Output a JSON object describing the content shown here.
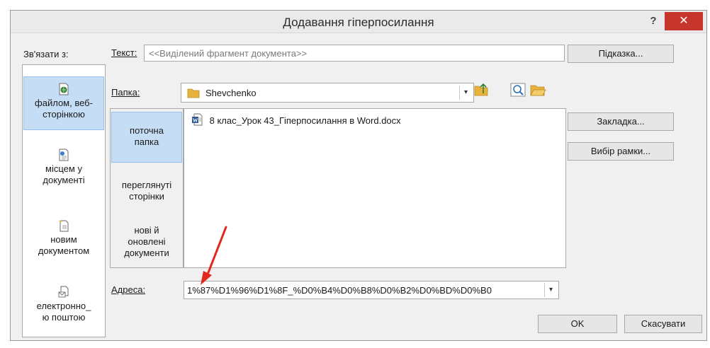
{
  "dialog": {
    "title": "Додавання гіперпосилання",
    "help_label": "?",
    "close_label": "✕"
  },
  "link_to": {
    "label": "Зв'язати з:",
    "items": [
      {
        "label_line1": "файлом, веб-",
        "label_line2": "сторінкою",
        "icon": "web-file-icon",
        "selected": true
      },
      {
        "label_line1": "місцем у",
        "label_line2": "документі",
        "icon": "place-in-document-icon",
        "selected": false
      },
      {
        "label_line1": "новим",
        "label_line2": "документом",
        "icon": "new-document-icon",
        "selected": false
      },
      {
        "label_line1": "електронно_",
        "label_line2": "ю поштою",
        "icon": "email-icon",
        "selected": false
      }
    ]
  },
  "text_to_display": {
    "label": "Текст:",
    "value": "<<Виділений фрагмент документа>>"
  },
  "buttons": {
    "screentip": "Підказка...",
    "bookmark": "Закладка...",
    "target_frame": "Вибір рамки...",
    "ok": "OK",
    "cancel": "Скасувати"
  },
  "folder": {
    "label": "Папка:",
    "value": "Shevchenko"
  },
  "look_in": {
    "items": [
      {
        "line1": "поточна",
        "line2": "папка",
        "line3": "",
        "selected": true
      },
      {
        "line1": "переглянуті",
        "line2": "сторінки",
        "line3": "",
        "selected": false
      },
      {
        "line1": "нові й",
        "line2": "оновлені",
        "line3": "документи",
        "selected": false
      }
    ]
  },
  "files": [
    {
      "name": "8 клас_Урок 43_Гіперпосилання в Word.docx",
      "icon": "word-document-icon"
    }
  ],
  "address": {
    "label": "Адреса:",
    "value": "1%87%D1%96%D1%8F_%D0%B4%D0%B8%D0%B2%D0%BD%D0%B0"
  },
  "colors": {
    "selection": "#c5ddf5",
    "close_button": "#c7362d",
    "annotation_arrow": "#e3271c"
  }
}
